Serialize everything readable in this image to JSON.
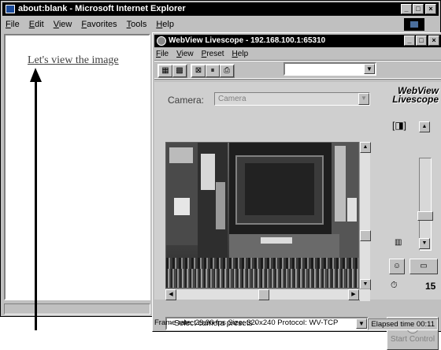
{
  "ie": {
    "title": "about:blank - Microsoft Internet Explorer",
    "menu": [
      "File",
      "Edit",
      "View",
      "Favorites",
      "Tools",
      "Help"
    ],
    "link_text": "Let's view the  image"
  },
  "webview": {
    "title": "WebView Livescope - 192.168.100.1:65310",
    "menu": [
      "File",
      "View",
      "Preset",
      "Help"
    ],
    "camera_label": "Camera:",
    "camera_value": "Camera",
    "logo_line1": "WebView",
    "logo_line2": "Livescope",
    "fps_value": "15",
    "preset_placeholder": "- Select camera presets -",
    "start_control_label": "Start Control",
    "status_line": "Frame rate: 29.90 fps  Size: 320x240   Protocol: WV-TCP",
    "elapsed": "Elapsed time 00:11"
  },
  "icons": {
    "ie_window_icon": "ie-logo-icon",
    "webview_window_icon": "webview-icon"
  }
}
